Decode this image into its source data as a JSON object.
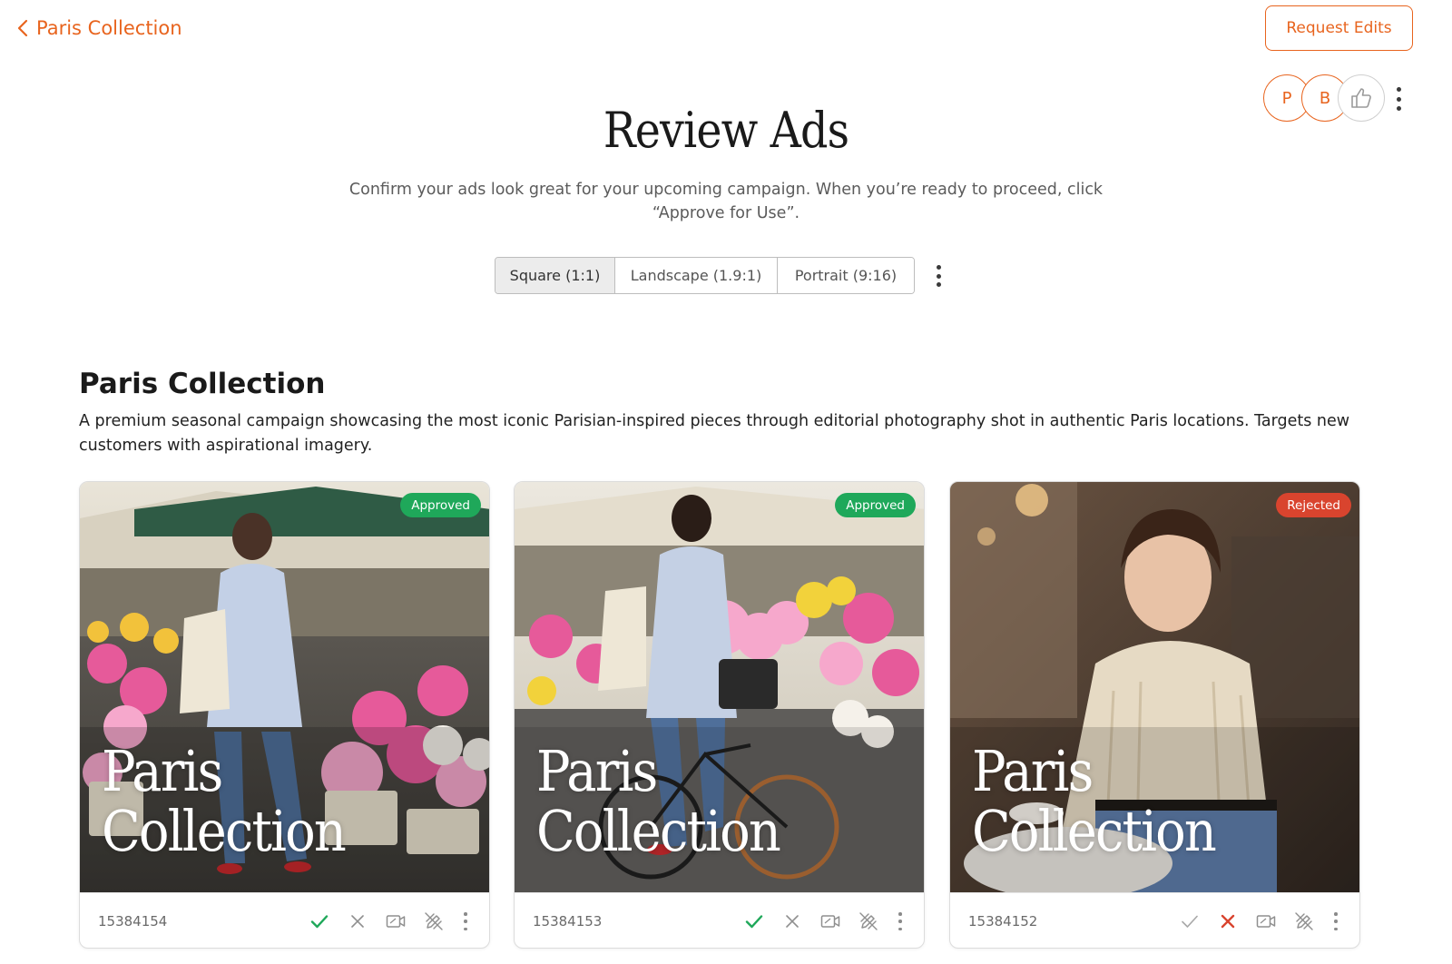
{
  "nav": {
    "back_label": "Paris Collection"
  },
  "header": {
    "request_edits_label": "Request Edits",
    "avatars": [
      "P",
      "B"
    ]
  },
  "page": {
    "title": "Review Ads",
    "subtitle": "Confirm your ads look great for your upcoming campaign. When you’re ready to proceed, click “Approve for Use”."
  },
  "formats": {
    "tabs": [
      "Square (1:1)",
      "Landscape (1.9:1)",
      "Portrait (9:16)"
    ],
    "selected": "Square (1:1)"
  },
  "section": {
    "title": "Paris Collection",
    "description": "A premium seasonal campaign showcasing the most iconic Parisian-inspired pieces through editorial photography shot in authentic Paris locations. Targets new customers with aspirational imagery."
  },
  "ads": [
    {
      "id": "15384154",
      "status": "Approved",
      "status_color": "#1fa85a",
      "overlay_line1": "Paris",
      "overlay_line2": "Collection",
      "approved": true,
      "rejected": false
    },
    {
      "id": "15384153",
      "status": "Approved",
      "status_color": "#1fa85a",
      "overlay_line1": "Paris",
      "overlay_line2": "Collection",
      "approved": true,
      "rejected": false
    },
    {
      "id": "15384152",
      "status": "Rejected",
      "status_color": "#d9442e",
      "overlay_line1": "Paris",
      "overlay_line2": "Collection",
      "approved": false,
      "rejected": true
    }
  ],
  "colors": {
    "accent": "#e8641e",
    "approved": "#1fa85a",
    "rejected": "#d9442e"
  },
  "icons": [
    "chevron-left-icon",
    "thumbs-up-icon",
    "check-icon",
    "close-icon",
    "video-icon",
    "edit-off-icon",
    "more-vertical-icon"
  ]
}
